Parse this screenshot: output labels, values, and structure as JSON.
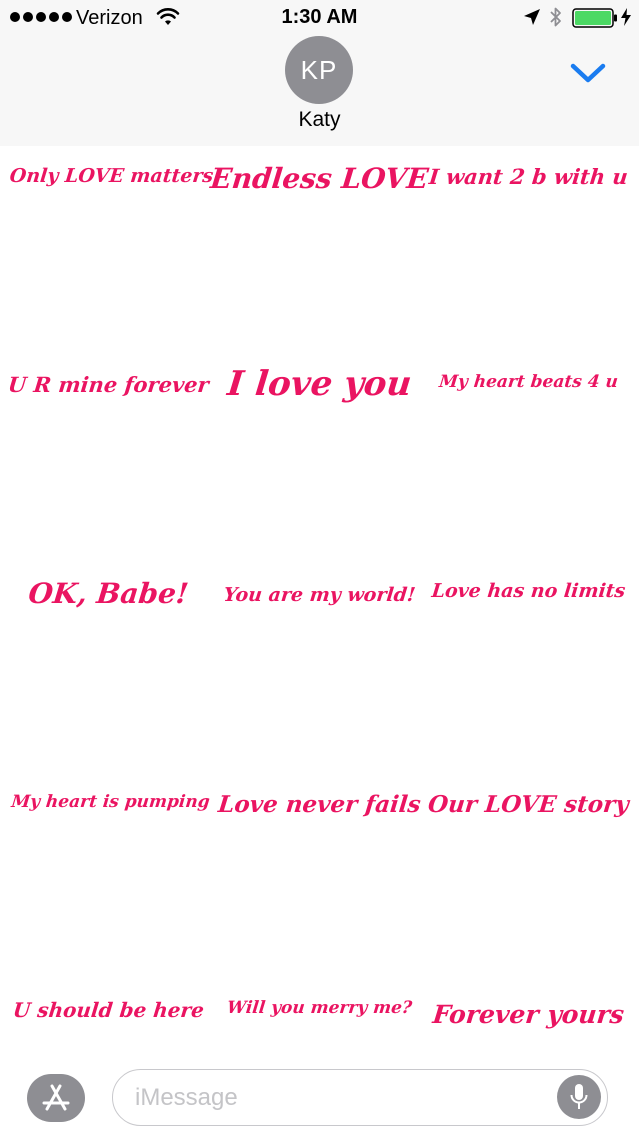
{
  "status_bar": {
    "carrier": "Verizon",
    "time": "1:30 AM",
    "signal_bars": 5,
    "battery_level": 1.0,
    "icons": [
      "signal-dots",
      "wifi-icon",
      "location-icon",
      "bluetooth-icon",
      "battery-icon",
      "charging-icon"
    ]
  },
  "header": {
    "avatar_initials": "KP",
    "contact_name": "Katy",
    "collapse_icon": "chevron-down-icon"
  },
  "colors": {
    "accent": "#1a7cf0",
    "sticker_text": "#ea1461",
    "avatar_bg": "#8e8e93"
  },
  "stickers": [
    {
      "text": "Only LOVE matters"
    },
    {
      "text": "Endless LOVE"
    },
    {
      "text": "I want 2 b with u"
    },
    {
      "text": "U R mine forever"
    },
    {
      "text": "I love you"
    },
    {
      "text": "My heart beats  4 u"
    },
    {
      "text": "OK, Babe!"
    },
    {
      "text": "You are my world!"
    },
    {
      "text": "Love has no limits"
    },
    {
      "text": "My heart is pumping"
    },
    {
      "text": "Love never fails"
    },
    {
      "text": "Our LOVE story"
    },
    {
      "text": "U should be here"
    },
    {
      "text": "Will you merry me?"
    },
    {
      "text": "Forever yours"
    }
  ],
  "input_bar": {
    "app_store_icon": "app-store-icon",
    "message_placeholder": "iMessage",
    "mic_icon": "microphone-icon"
  }
}
